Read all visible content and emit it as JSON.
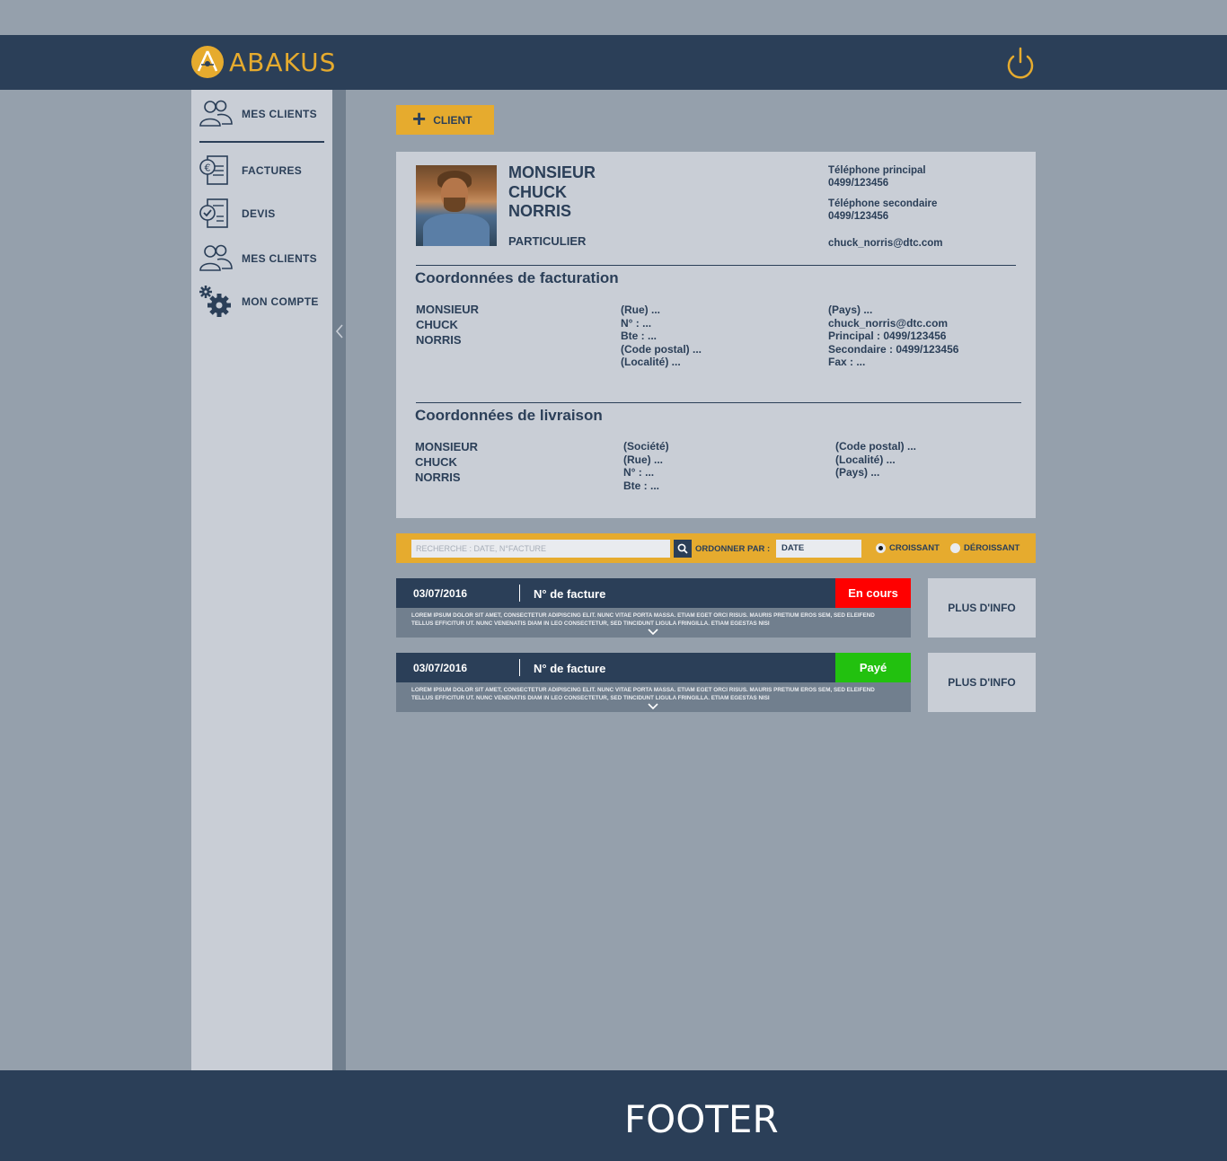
{
  "brand": {
    "name": "ABAKUS",
    "accent": "#e6ab2e",
    "navy": "#2b3f58"
  },
  "sidebar": {
    "items": [
      {
        "label": "MES CLIENTS",
        "icon": "users-icon"
      },
      {
        "label": "FACTURES",
        "icon": "invoice-euro-icon"
      },
      {
        "label": "DEVIS",
        "icon": "quote-check-icon"
      },
      {
        "label": "MES CLIENTS",
        "icon": "users-icon"
      },
      {
        "label": "MON COMPTE",
        "icon": "gears-icon"
      }
    ]
  },
  "toolbar": {
    "add_client_label": "CLIENT"
  },
  "client": {
    "civility": "MONSIEUR",
    "first_name": "CHUCK",
    "last_name": "NORRIS",
    "type": "PARTICULIER",
    "phone_primary_label": "Téléphone principal",
    "phone_primary": "0499/123456",
    "phone_secondary_label": "Téléphone secondaire",
    "phone_secondary": "0499/123456",
    "email": "chuck_norris@dtc.com"
  },
  "billing": {
    "title": "Coordonnées de facturation",
    "name": [
      "MONSIEUR",
      "CHUCK",
      "NORRIS"
    ],
    "address": [
      "(Rue) ...",
      "N° : ...",
      "Bte : ...",
      "(Code postal) ...",
      "(Localité) ..."
    ],
    "contact": [
      "(Pays) ...",
      "chuck_norris@dtc.com",
      "Principal : 0499/123456",
      "Secondaire : 0499/123456",
      "Fax : ..."
    ]
  },
  "delivery": {
    "title": "Coordonnées de livraison",
    "name": [
      "MONSIEUR",
      "CHUCK",
      "NORRIS"
    ],
    "address": [
      "(Société)",
      "(Rue) ...",
      "N° : ...",
      "Bte : ..."
    ],
    "location": [
      "(Code postal) ...",
      "(Localité) ...",
      "(Pays) ..."
    ]
  },
  "filter": {
    "search_placeholder": "RECHERCHE : DATE, N°FACTURE",
    "order_label": "ORDONNER PAR :",
    "order_value": "DATE",
    "asc_label": "CROISSANT",
    "desc_label": "DÉROISSANT",
    "selected": "asc"
  },
  "invoices": [
    {
      "date": "03/07/2016",
      "number_label": "N° de facture",
      "status": "En cours",
      "status_color": "#ff0000",
      "description": "LOREM IPSUM DOLOR SIT AMET, CONSECTETUR ADIPISCING ELIT. NUNC VITAE PORTA MASSA. ETIAM EGET ORCI RISUS. MAURIS PRETIUM EROS SEM, SED ELEIFEND TELLUS EFFICITUR UT. NUNC VENENATIS DIAM IN LEO CONSECTETUR, SED TINCIDUNT LIGULA FRINGILLA. ETIAM EGESTAS NISI",
      "more_label": "PLUS D'INFO"
    },
    {
      "date": "03/07/2016",
      "number_label": "N° de facture",
      "status": "Payé",
      "status_color": "#22c10f",
      "description": "LOREM IPSUM DOLOR SIT AMET, CONSECTETUR ADIPISCING ELIT. NUNC VITAE PORTA MASSA. ETIAM EGET ORCI RISUS. MAURIS PRETIUM EROS SEM, SED ELEIFEND TELLUS EFFICITUR UT. NUNC VENENATIS DIAM IN LEO CONSECTETUR, SED TINCIDUNT LIGULA FRINGILLA. ETIAM EGESTAS NISI",
      "more_label": "PLUS D'INFO"
    }
  ],
  "footer": {
    "text": "FOOTER"
  }
}
